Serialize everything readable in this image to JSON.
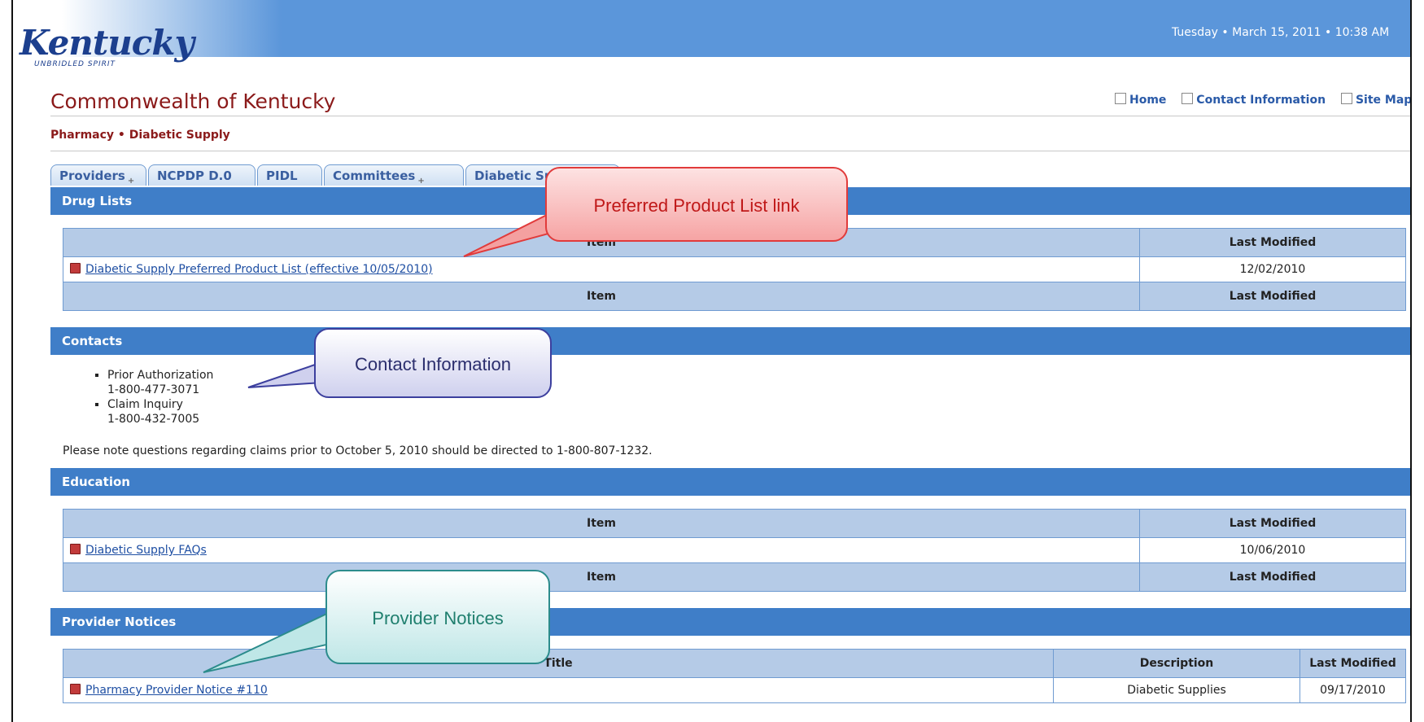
{
  "header": {
    "logo_text": "Kentucky",
    "logo_subtext": "UNBRIDLED SPIRIT",
    "datetime": "Tuesday • March 15, 2011 • 10:38 AM",
    "site_title": "Commonwealth of Kentucky",
    "links": [
      "Home",
      "Contact Information",
      "Site Map"
    ]
  },
  "breadcrumb": "Pharmacy • Diabetic Supply",
  "tabs": [
    "Providers",
    "NCPDP D.0",
    "PIDL",
    "Committees",
    "Diabetic Suppl"
  ],
  "drug_lists": {
    "title": "Drug Lists",
    "col_item": "Item",
    "col_modified": "Last Modified",
    "rows": [
      {
        "item": "Diabetic Supply Preferred Product List (effective 10/05/2010)",
        "modified": "12/02/2010"
      }
    ]
  },
  "contacts": {
    "title": "Contacts",
    "items": [
      {
        "label": "Prior Authorization",
        "phone": "1-800-477-3071"
      },
      {
        "label": "Claim Inquiry",
        "phone": "1-800-432-7005"
      }
    ],
    "note": "Please note questions regarding claims prior to October 5, 2010 should be directed to 1-800-807-1232."
  },
  "education": {
    "title": "Education",
    "col_item": "Item",
    "col_modified": "Last Modified",
    "rows": [
      {
        "item": "Diabetic Supply FAQs",
        "modified": "10/06/2010"
      }
    ]
  },
  "provider_notices": {
    "title": "Provider Notices",
    "col_title": "Title",
    "col_description": "Description",
    "col_modified": "Last Modified",
    "rows": [
      {
        "title": "Pharmacy Provider Notice #110",
        "description": "Diabetic Supplies",
        "modified": "09/17/2010"
      }
    ]
  },
  "callouts": {
    "preferred": "Preferred Product List link",
    "contact": "Contact Information",
    "notices": "Provider Notices"
  },
  "colors": {
    "banner_blue": "#5b96da",
    "section_blue": "#3f7ec8",
    "header_cell": "#b5cbe7",
    "title_red": "#8b1a1a",
    "link_blue": "#1f4fa3"
  }
}
